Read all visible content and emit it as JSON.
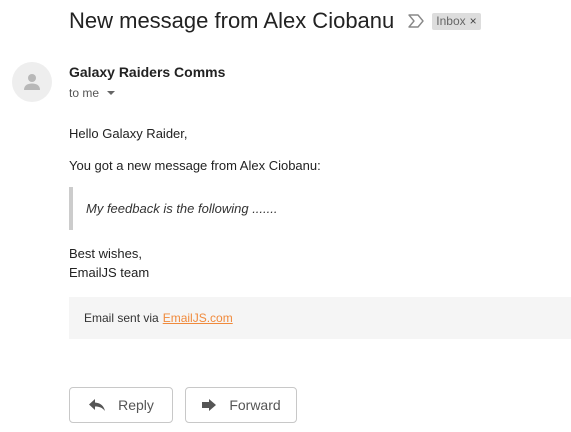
{
  "email": {
    "subject": "New message from Alex Ciobanu",
    "label": "Inbox",
    "label_remove": "×",
    "sender_name": "Galaxy Raiders Comms",
    "recipient": "to me",
    "greeting": "Hello Galaxy Raider,",
    "intro": "You got a new message from Alex Ciobanu:",
    "quote": "My feedback is the following .......",
    "closing_1": "Best wishes,",
    "closing_2": "EmailJS team",
    "footer_prefix": "Email sent via",
    "footer_link": "EmailJS.com"
  },
  "actions": {
    "reply_label": "Reply",
    "forward_label": "Forward"
  },
  "icons": {
    "important": "important-marker-icon",
    "avatar": "person-icon",
    "reply": "reply-arrow-icon",
    "forward": "forward-arrow-icon"
  },
  "colors": {
    "link": "#f08a3c",
    "chip_bg": "#dddddd",
    "footer_bg": "#f5f5f5"
  }
}
